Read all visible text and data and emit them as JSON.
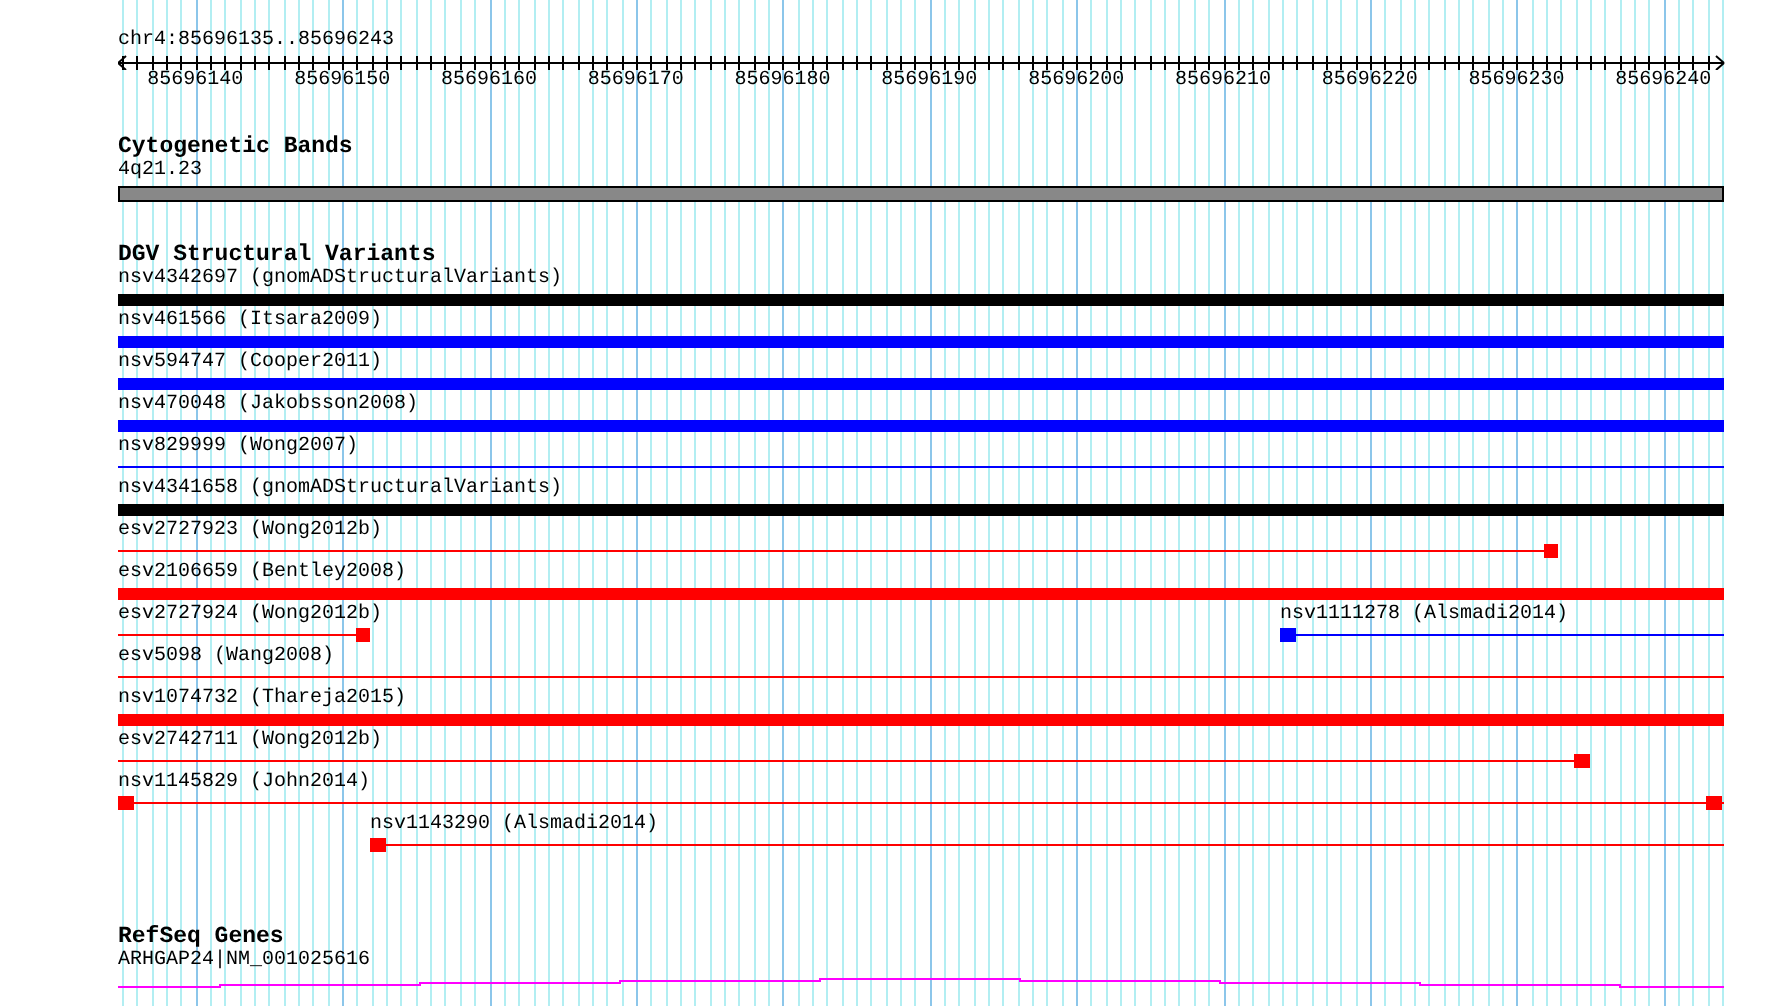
{
  "location": "chr4:85696135..85696243",
  "ruler": {
    "labels": [
      "85696140",
      "85696150",
      "85696160",
      "85696170",
      "85696180",
      "85696190",
      "85696200",
      "85696210",
      "85696220",
      "85696230",
      "85696240"
    ]
  },
  "cytogenetic_bands": {
    "title": "Cytogenetic Bands",
    "band_label": "4q21.23"
  },
  "dgv_structural_variants": {
    "title": "DGV Structural Variants",
    "rows": [
      [
        {
          "label": "nsv4342697 (gnomADStructuralVariants)",
          "kind": "thick",
          "color": "#000000"
        }
      ],
      [
        {
          "label": "nsv461566 (Itsara2009)",
          "kind": "thick",
          "color": "#0000ff"
        }
      ],
      [
        {
          "label": "nsv594747 (Cooper2011)",
          "kind": "thick",
          "color": "#0000ff"
        }
      ],
      [
        {
          "label": "nsv470048 (Jakobsson2008)",
          "kind": "thick",
          "color": "#0000ff"
        }
      ],
      [
        {
          "label": "nsv829999 (Wong2007)",
          "kind": "thin",
          "color": "#0000ff"
        }
      ],
      [
        {
          "label": "nsv4341658 (gnomADStructuralVariants)",
          "kind": "thick",
          "color": "#000000"
        }
      ],
      [
        {
          "label": "esv2727923 (Wong2012b)",
          "kind": "thin",
          "color": "#ff0000"
        }
      ],
      [
        {
          "label": "esv2106659 (Bentley2008)",
          "kind": "thick",
          "color": "#ff0000"
        }
      ],
      [
        {
          "label": "esv2727924 (Wong2012b)",
          "kind": "thin",
          "color": "#ff0000"
        },
        {
          "label": "nsv1111278 (Alsmadi2014)",
          "kind": "thin",
          "color": "#0000ff"
        }
      ],
      [
        {
          "label": "esv5098 (Wang2008)",
          "kind": "thin",
          "color": "#ff0000"
        }
      ],
      [
        {
          "label": "nsv1074732 (Thareja2015)",
          "kind": "thick",
          "color": "#ff0000"
        }
      ],
      [
        {
          "label": "esv2742711 (Wong2012b)",
          "kind": "thin",
          "color": "#ff0000"
        }
      ],
      [
        {
          "label": "nsv1145829 (John2014)",
          "kind": "thin",
          "color": "#ff0000"
        }
      ],
      [
        {
          "label": "nsv1143290 (Alsmadi2014)",
          "kind": "thin",
          "color": "#ff0000"
        }
      ]
    ]
  },
  "refseq_genes": {
    "title": "RefSeq Genes",
    "gene_label": "ARHGAP24|NM_001025616"
  }
}
